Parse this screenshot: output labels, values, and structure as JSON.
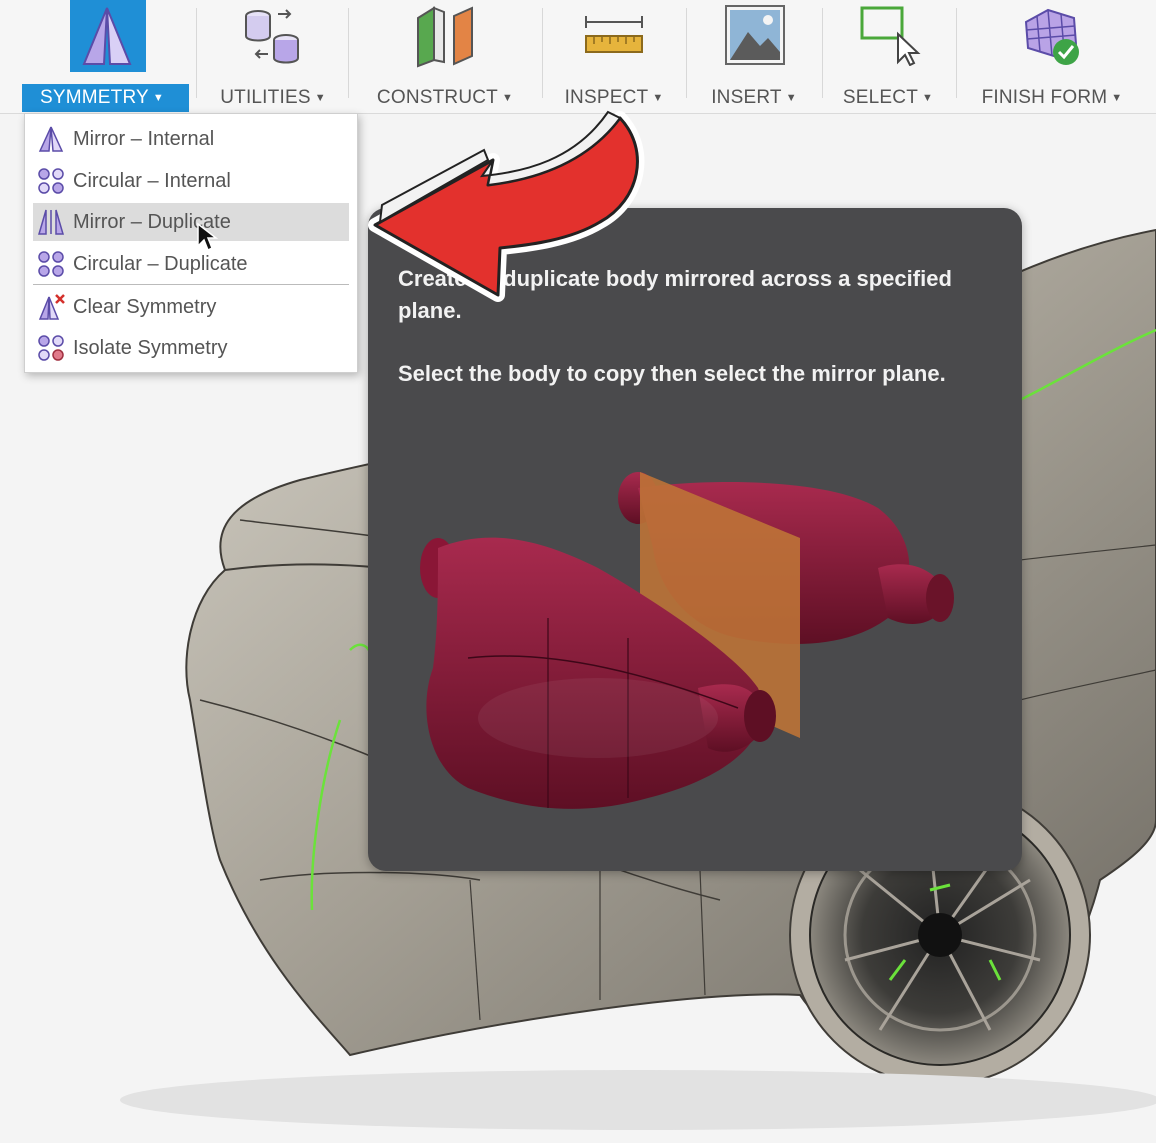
{
  "toolbar": {
    "tabs": [
      {
        "label": "SYMMETRY",
        "icon": "symmetry-icon",
        "active": true
      },
      {
        "label": "UTILITIES",
        "icon": "utilities-icon"
      },
      {
        "label": "CONSTRUCT",
        "icon": "construct-icon"
      },
      {
        "label": "INSPECT",
        "icon": "inspect-icon"
      },
      {
        "label": "INSERT",
        "icon": "insert-image-icon"
      },
      {
        "label": "SELECT",
        "icon": "select-icon"
      },
      {
        "label": "FINISH FORM",
        "icon": "finish-form-icon"
      }
    ],
    "caret": "▼",
    "active_color": "#1f8fd6"
  },
  "symmetry_menu": {
    "items": [
      {
        "label": "Mirror – Internal",
        "icon": "mirror-internal-icon"
      },
      {
        "label": "Circular – Internal",
        "icon": "circular-internal-icon"
      },
      {
        "label": "Mirror – Duplicate",
        "icon": "mirror-duplicate-icon",
        "hovered": true
      },
      {
        "label": "Circular – Duplicate",
        "icon": "circular-duplicate-icon"
      },
      {
        "label": "Clear Symmetry",
        "icon": "clear-symmetry-icon"
      },
      {
        "label": "Isolate Symmetry",
        "icon": "isolate-symmetry-icon"
      }
    ]
  },
  "tooltip": {
    "description": "Creates a duplicate body mirrored across a specified plane.",
    "instruction": "Select the body to copy then select the mirror plane.",
    "body_color": "#8a1636",
    "plane_color": "#c8912e"
  },
  "annotation": {
    "arrow_color": "#e3312d"
  }
}
